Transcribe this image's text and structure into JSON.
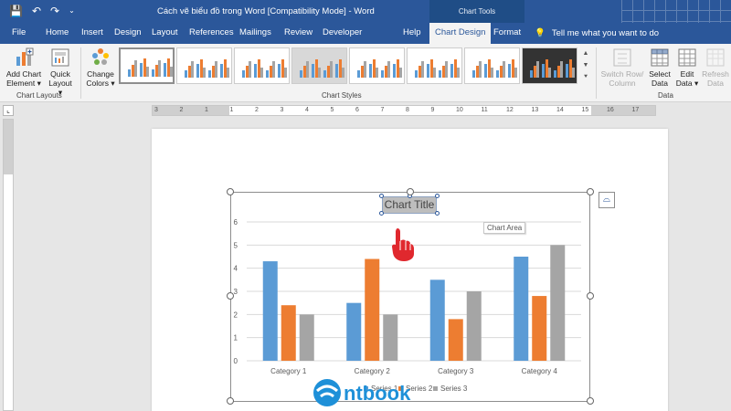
{
  "titlebar": {
    "doc_title": "Cách vẽ biểu đồ trong Word [Compatibility Mode]  -  Word",
    "context_label": "Chart Tools"
  },
  "tabs": [
    "File",
    "Home",
    "Insert",
    "Design",
    "Layout",
    "References",
    "Mailings",
    "Review",
    "Developer",
    "Help",
    "Chart Design",
    "Format"
  ],
  "active_tab": "Chart Design",
  "tell_me": "Tell me what you want to do",
  "ribbon": {
    "add_chart_element": "Add Chart Element",
    "quick_layout": "Quick Layout",
    "group_chart_layouts": "Chart Layouts",
    "change_colors": "Change Colors",
    "group_chart_styles": "Chart Styles",
    "switch_row_column": "Switch Row/ Column",
    "select_data": "Select Data",
    "edit_data": "Edit Data",
    "refresh_data": "Refresh Data",
    "group_data": "Data"
  },
  "ruler_numbers": [
    "3",
    "2",
    "1",
    "1",
    "2",
    "3",
    "4",
    "5",
    "6",
    "7",
    "8",
    "9",
    "10",
    "11",
    "12",
    "13",
    "14",
    "15",
    "16",
    "17"
  ],
  "chart_area_tooltip": "Chart Area",
  "chart_data": {
    "type": "bar",
    "title": "Chart Title",
    "categories": [
      "Category 1",
      "Category 2",
      "Category 3",
      "Category 4"
    ],
    "series": [
      {
        "name": "Series 1",
        "values": [
          4.3,
          2.5,
          3.5,
          4.5
        ],
        "color": "#5b9bd5"
      },
      {
        "name": "Series 2",
        "values": [
          2.4,
          4.4,
          1.8,
          2.8
        ],
        "color": "#ed7d31"
      },
      {
        "name": "Series 3",
        "values": [
          2.0,
          2.0,
          3.0,
          5.0
        ],
        "color": "#a5a5a5"
      }
    ],
    "ylim": [
      0,
      6
    ],
    "y_ticks": [
      0,
      1,
      2,
      3,
      4,
      5,
      6
    ],
    "grid": true,
    "legend": "bottom"
  },
  "watermark": "ntbook"
}
